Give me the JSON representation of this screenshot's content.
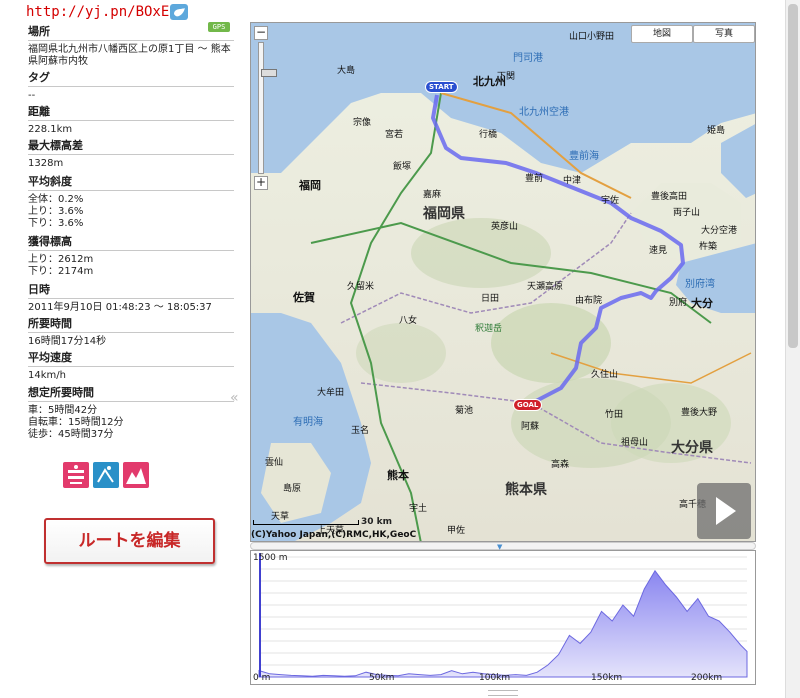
{
  "header": {
    "short_url": "http://yj.pn/BOxEjp",
    "gps_badge": "GPS"
  },
  "info": {
    "place_label": "場所",
    "place_value": "福岡県北九州市八幡西区上の原1丁目 〜 熊本県阿蘇市内牧",
    "tag_label": "タグ",
    "tag_value": "--",
    "distance_label": "距離",
    "distance_value": "228.1km",
    "max_elev_label": "最大標高差",
    "max_elev_value": "1328m",
    "avg_grade_label": "平均斜度",
    "avg_grade_all": "全体：0.2%",
    "avg_grade_up": "上り：3.6%",
    "avg_grade_down": "下り：3.6%",
    "gain_label": "獲得標高",
    "gain_up": "上り：2612m",
    "gain_down": "下り：2174m",
    "date_label": "日時",
    "date_value": "2011年9月10日 01:48:23 〜 18:05:37",
    "duration_label": "所要時間",
    "duration_value": "16時間17分14秒",
    "avg_speed_label": "平均速度",
    "avg_speed_value": "14km/h",
    "est_label": "想定所要時間",
    "est_car": "車：5時間42分",
    "est_bike": "自転車：15時間12分",
    "est_walk": "徒歩：45時間37分"
  },
  "buttons": {
    "edit_route": "ルートを編集"
  },
  "icons": {
    "twitter": "twitter-bird-icon",
    "mode_walk": "walk-mode-icon",
    "mode_bike": "bike-mode-icon",
    "mode_elevation": "elevation-mode-icon",
    "play": "play-icon",
    "collapse": "double-chevron-left-icon"
  },
  "map": {
    "map_button": "地図",
    "photo_button": "写真",
    "zoom_in": "+",
    "zoom_out": "−",
    "scale": "30 km",
    "copyright": "(C)Yahoo Japan,(C)RMC,HK,GeoC",
    "start_pin": "START",
    "goal_pin": "GOAL",
    "labels": {
      "l1": "山口小野田",
      "l2": "門司港",
      "l3": "下関",
      "l4": "大島",
      "l5": "北九州",
      "l6": "北九州空港",
      "l7": "宗像",
      "l8": "宮若",
      "l9": "行橋",
      "l10": "福岡",
      "l11": "飯塚",
      "l12": "嘉麻",
      "l13": "豊前",
      "l14": "中津",
      "l15": "姫島",
      "l16": "福岡県",
      "l17": "豊後高田",
      "l18": "宇佐",
      "l19": "英彦山",
      "l20": "杵築",
      "l21": "速見",
      "l22": "別府湾",
      "l23": "佐賀",
      "l24": "久留米",
      "l25": "日田",
      "l26": "天瀬高原",
      "l27": "由布院",
      "l28": "別府",
      "l29": "大分",
      "l30": "八女",
      "l31": "釈迦岳",
      "l32": "久住山",
      "l33": "竹田",
      "l34": "豊後大野",
      "l35": "大分県",
      "l36": "大牟田",
      "l37": "菊池",
      "l38": "阿蘇",
      "l39": "熊本",
      "l40": "熊本県",
      "l41": "天草",
      "l42": "雲仙",
      "l43": "宇土",
      "l44": "高森",
      "l45": "祖母山",
      "l46": "豊前海",
      "l47": "有明海",
      "l48": "島原",
      "l49": "玉名",
      "l50": "大分空港",
      "l51": "両子山",
      "l52": "上天草",
      "l53": "高千穂",
      "l54": "甲佐"
    }
  },
  "elevation": {
    "ymax_label": "1500 m",
    "ymin_label": "0 m",
    "ticks": [
      "50km",
      "100km",
      "150km",
      "200km"
    ],
    "profile_km": [
      0,
      5,
      10,
      15,
      20,
      25,
      30,
      35,
      40,
      45,
      50,
      55,
      60,
      65,
      70,
      75,
      80,
      85,
      90,
      95,
      100,
      105,
      110,
      115,
      120,
      125,
      130,
      135,
      140,
      145,
      150,
      155,
      160,
      165,
      170,
      175,
      180,
      185,
      190,
      195,
      200,
      205,
      210,
      215,
      220,
      225,
      228
    ],
    "profile_m": [
      80,
      40,
      30,
      20,
      15,
      10,
      20,
      15,
      10,
      15,
      60,
      30,
      20,
      15,
      40,
      30,
      20,
      30,
      80,
      40,
      60,
      40,
      30,
      20,
      30,
      20,
      60,
      150,
      280,
      520,
      420,
      560,
      820,
      700,
      900,
      760,
      1100,
      1328,
      1150,
      1000,
      820,
      980,
      760,
      700,
      560,
      400,
      320
    ]
  }
}
